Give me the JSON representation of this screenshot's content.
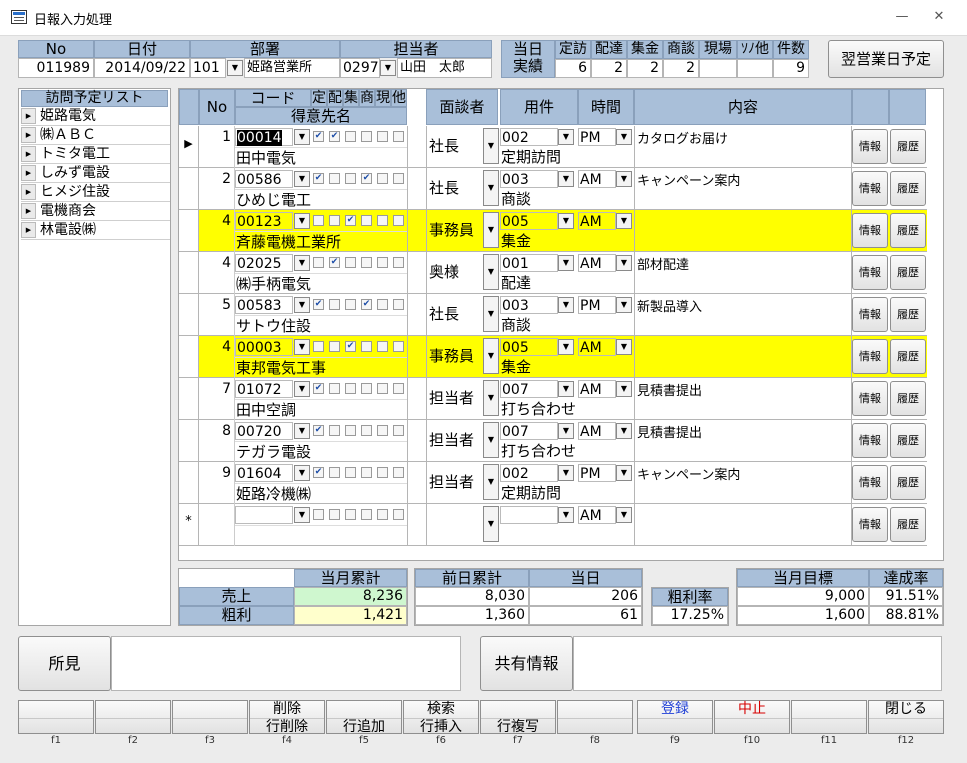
{
  "window": {
    "title": "日報入力処理"
  },
  "header": {
    "no_label": "No",
    "date_label": "日付",
    "dept_label": "部署",
    "staff_label": "担当者",
    "no": "011989",
    "date": "2014/09/22",
    "dept_code": "101",
    "dept_name": "姫路営業所",
    "staff_code": "0297",
    "staff_name": "山田　太郎"
  },
  "results": {
    "label1": "当日",
    "label2": "実績",
    "cols": [
      "定訪",
      "配達",
      "集金",
      "商談",
      "現場",
      "ｿﾉ他",
      "件数"
    ],
    "vals": [
      "6",
      "2",
      "2",
      "2",
      "",
      "",
      "9"
    ]
  },
  "next_day_button": "翌営業日予定",
  "visit_list": {
    "title": "訪問予定リスト",
    "items": [
      "姫路電気",
      "㈱ＡＢＣ",
      "トミタ電工",
      "しみず電設",
      "ヒメジ住設",
      "電機商会",
      "林電設㈱"
    ]
  },
  "grid": {
    "headers": {
      "no": "No",
      "code": "コード",
      "flags": [
        "定",
        "配",
        "集",
        "商",
        "現",
        "他"
      ],
      "customer": "得意先名",
      "contact": "面談者",
      "purpose": "用件",
      "time": "時間",
      "content": "内容"
    },
    "info_label": "情報",
    "history_label": "履歴",
    "new_row_marker": "*",
    "new_row_time": "AM",
    "rows": [
      {
        "no": "1",
        "code": "00014",
        "checks": [
          true,
          true,
          false,
          false,
          false,
          false
        ],
        "customer": "田中電気",
        "contact": "社長",
        "purpose_code": "002",
        "purpose": "定期訪問",
        "time": "PM",
        "content": "カタログお届け",
        "highlight": false
      },
      {
        "no": "2",
        "code": "00586",
        "checks": [
          true,
          false,
          false,
          true,
          false,
          false
        ],
        "customer": "ひめじ電工",
        "contact": "社長",
        "purpose_code": "003",
        "purpose": "商談",
        "time": "AM",
        "content": "キャンペーン案内",
        "highlight": false
      },
      {
        "no": "4",
        "code": "00123",
        "checks": [
          false,
          false,
          true,
          false,
          false,
          false
        ],
        "customer": "斉藤電機工業所",
        "contact": "事務員",
        "purpose_code": "005",
        "purpose": "集金",
        "time": "AM",
        "content": "",
        "highlight": true
      },
      {
        "no": "4",
        "code": "02025",
        "checks": [
          false,
          true,
          false,
          false,
          false,
          false
        ],
        "customer": "㈱手柄電気",
        "contact": "奥様",
        "purpose_code": "001",
        "purpose": "配達",
        "time": "AM",
        "content": "部材配達",
        "highlight": false
      },
      {
        "no": "5",
        "code": "00583",
        "checks": [
          true,
          false,
          false,
          true,
          false,
          false
        ],
        "customer": "サトウ住設",
        "contact": "社長",
        "purpose_code": "003",
        "purpose": "商談",
        "time": "PM",
        "content": "新製品導入",
        "highlight": false
      },
      {
        "no": "4",
        "code": "00003",
        "checks": [
          false,
          false,
          true,
          false,
          false,
          false
        ],
        "customer": "東邦電気工事",
        "contact": "事務員",
        "purpose_code": "005",
        "purpose": "集金",
        "time": "AM",
        "content": "",
        "highlight": true
      },
      {
        "no": "7",
        "code": "01072",
        "checks": [
          true,
          false,
          false,
          false,
          false,
          false
        ],
        "customer": "田中空調",
        "contact": "担当者",
        "purpose_code": "007",
        "purpose": "打ち合わせ",
        "time": "AM",
        "content": "見積書提出",
        "highlight": false
      },
      {
        "no": "8",
        "code": "00720",
        "checks": [
          true,
          false,
          false,
          false,
          false,
          false
        ],
        "customer": "テガラ電設",
        "contact": "担当者",
        "purpose_code": "007",
        "purpose": "打ち合わせ",
        "time": "AM",
        "content": "見積書提出",
        "highlight": false
      },
      {
        "no": "9",
        "code": "01604",
        "checks": [
          true,
          false,
          false,
          false,
          false,
          false
        ],
        "customer": "姫路冷機㈱",
        "contact": "担当者",
        "purpose_code": "002",
        "purpose": "定期訪問",
        "time": "PM",
        "content": "キャンペーン案内",
        "highlight": false
      }
    ]
  },
  "totals": {
    "monthly_label": "当月累計",
    "prev_label": "前日累計",
    "today_label": "当日",
    "sales_label": "売上",
    "profit_label": "粗利",
    "sales_monthly": "8,236",
    "profit_monthly": "1,421",
    "sales_prev": "8,030",
    "profit_prev": "1,360",
    "sales_today": "206",
    "profit_today": "61",
    "margin_label": "粗利率",
    "margin": "17.25%",
    "target_label": "当月目標",
    "achieve_label": "達成率",
    "sales_target": "9,000",
    "profit_target": "1,600",
    "sales_achieve": "91.51%",
    "profit_achieve": "88.81%"
  },
  "notes": {
    "opinion_label": "所見",
    "share_label": "共有情報"
  },
  "fkeys": {
    "f4_top": "削除",
    "f4_bottom": "行削除",
    "f5_bottom": "行追加",
    "f6_top": "検索",
    "f6_bottom": "行挿入",
    "f7_bottom": "行複写",
    "f9_top": "登録",
    "f10_top": "中止",
    "f12_top": "閉じる",
    "labels": [
      "f1",
      "f2",
      "f3",
      "f4",
      "f5",
      "f6",
      "f7",
      "f8",
      "f9",
      "f10",
      "f11",
      "f12"
    ],
    "register_color": "#1f3fd6",
    "cancel_color": "#d60000"
  }
}
